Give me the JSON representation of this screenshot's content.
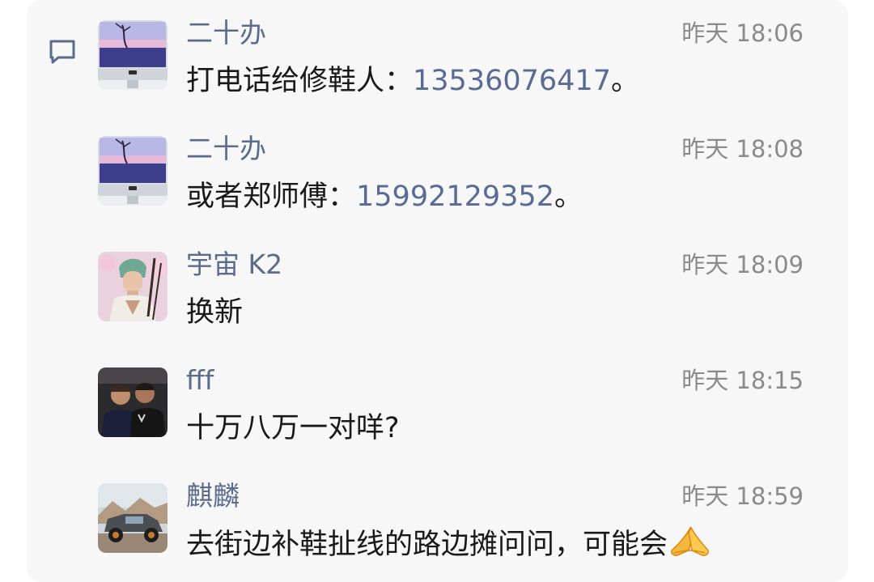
{
  "messages": [
    {
      "sender": "二十办",
      "time": "昨天 18:06",
      "text_before": "打电话给修鞋人：",
      "phone": "13536076417",
      "text_after": "。",
      "avatar": "imac-avatar"
    },
    {
      "sender": "二十办",
      "time": "昨天 18:08",
      "text_before": "或者郑师傅：",
      "phone": "15992129352",
      "text_after": "。",
      "avatar": "imac-avatar"
    },
    {
      "sender": "宇宙 K2",
      "time": "昨天 18:09",
      "text": "换新",
      "avatar": "anime-character-avatar"
    },
    {
      "sender": "fff",
      "time": "昨天 18:15",
      "text": "十万八万一对咩?",
      "avatar": "two-men-photo-avatar"
    },
    {
      "sender": "麒麟",
      "time": "昨天 18:59",
      "text": "去街边补鞋扯线的路边摊问问，可能会",
      "emoji": "folded-hands-emoji",
      "avatar": "offroad-truck-avatar"
    }
  ],
  "icons": {
    "comment": "comment-icon"
  },
  "colors": {
    "name": "#5a6b8c",
    "link": "#576b95",
    "time": "#8a8a8a",
    "panel": "#f7f7f7"
  }
}
